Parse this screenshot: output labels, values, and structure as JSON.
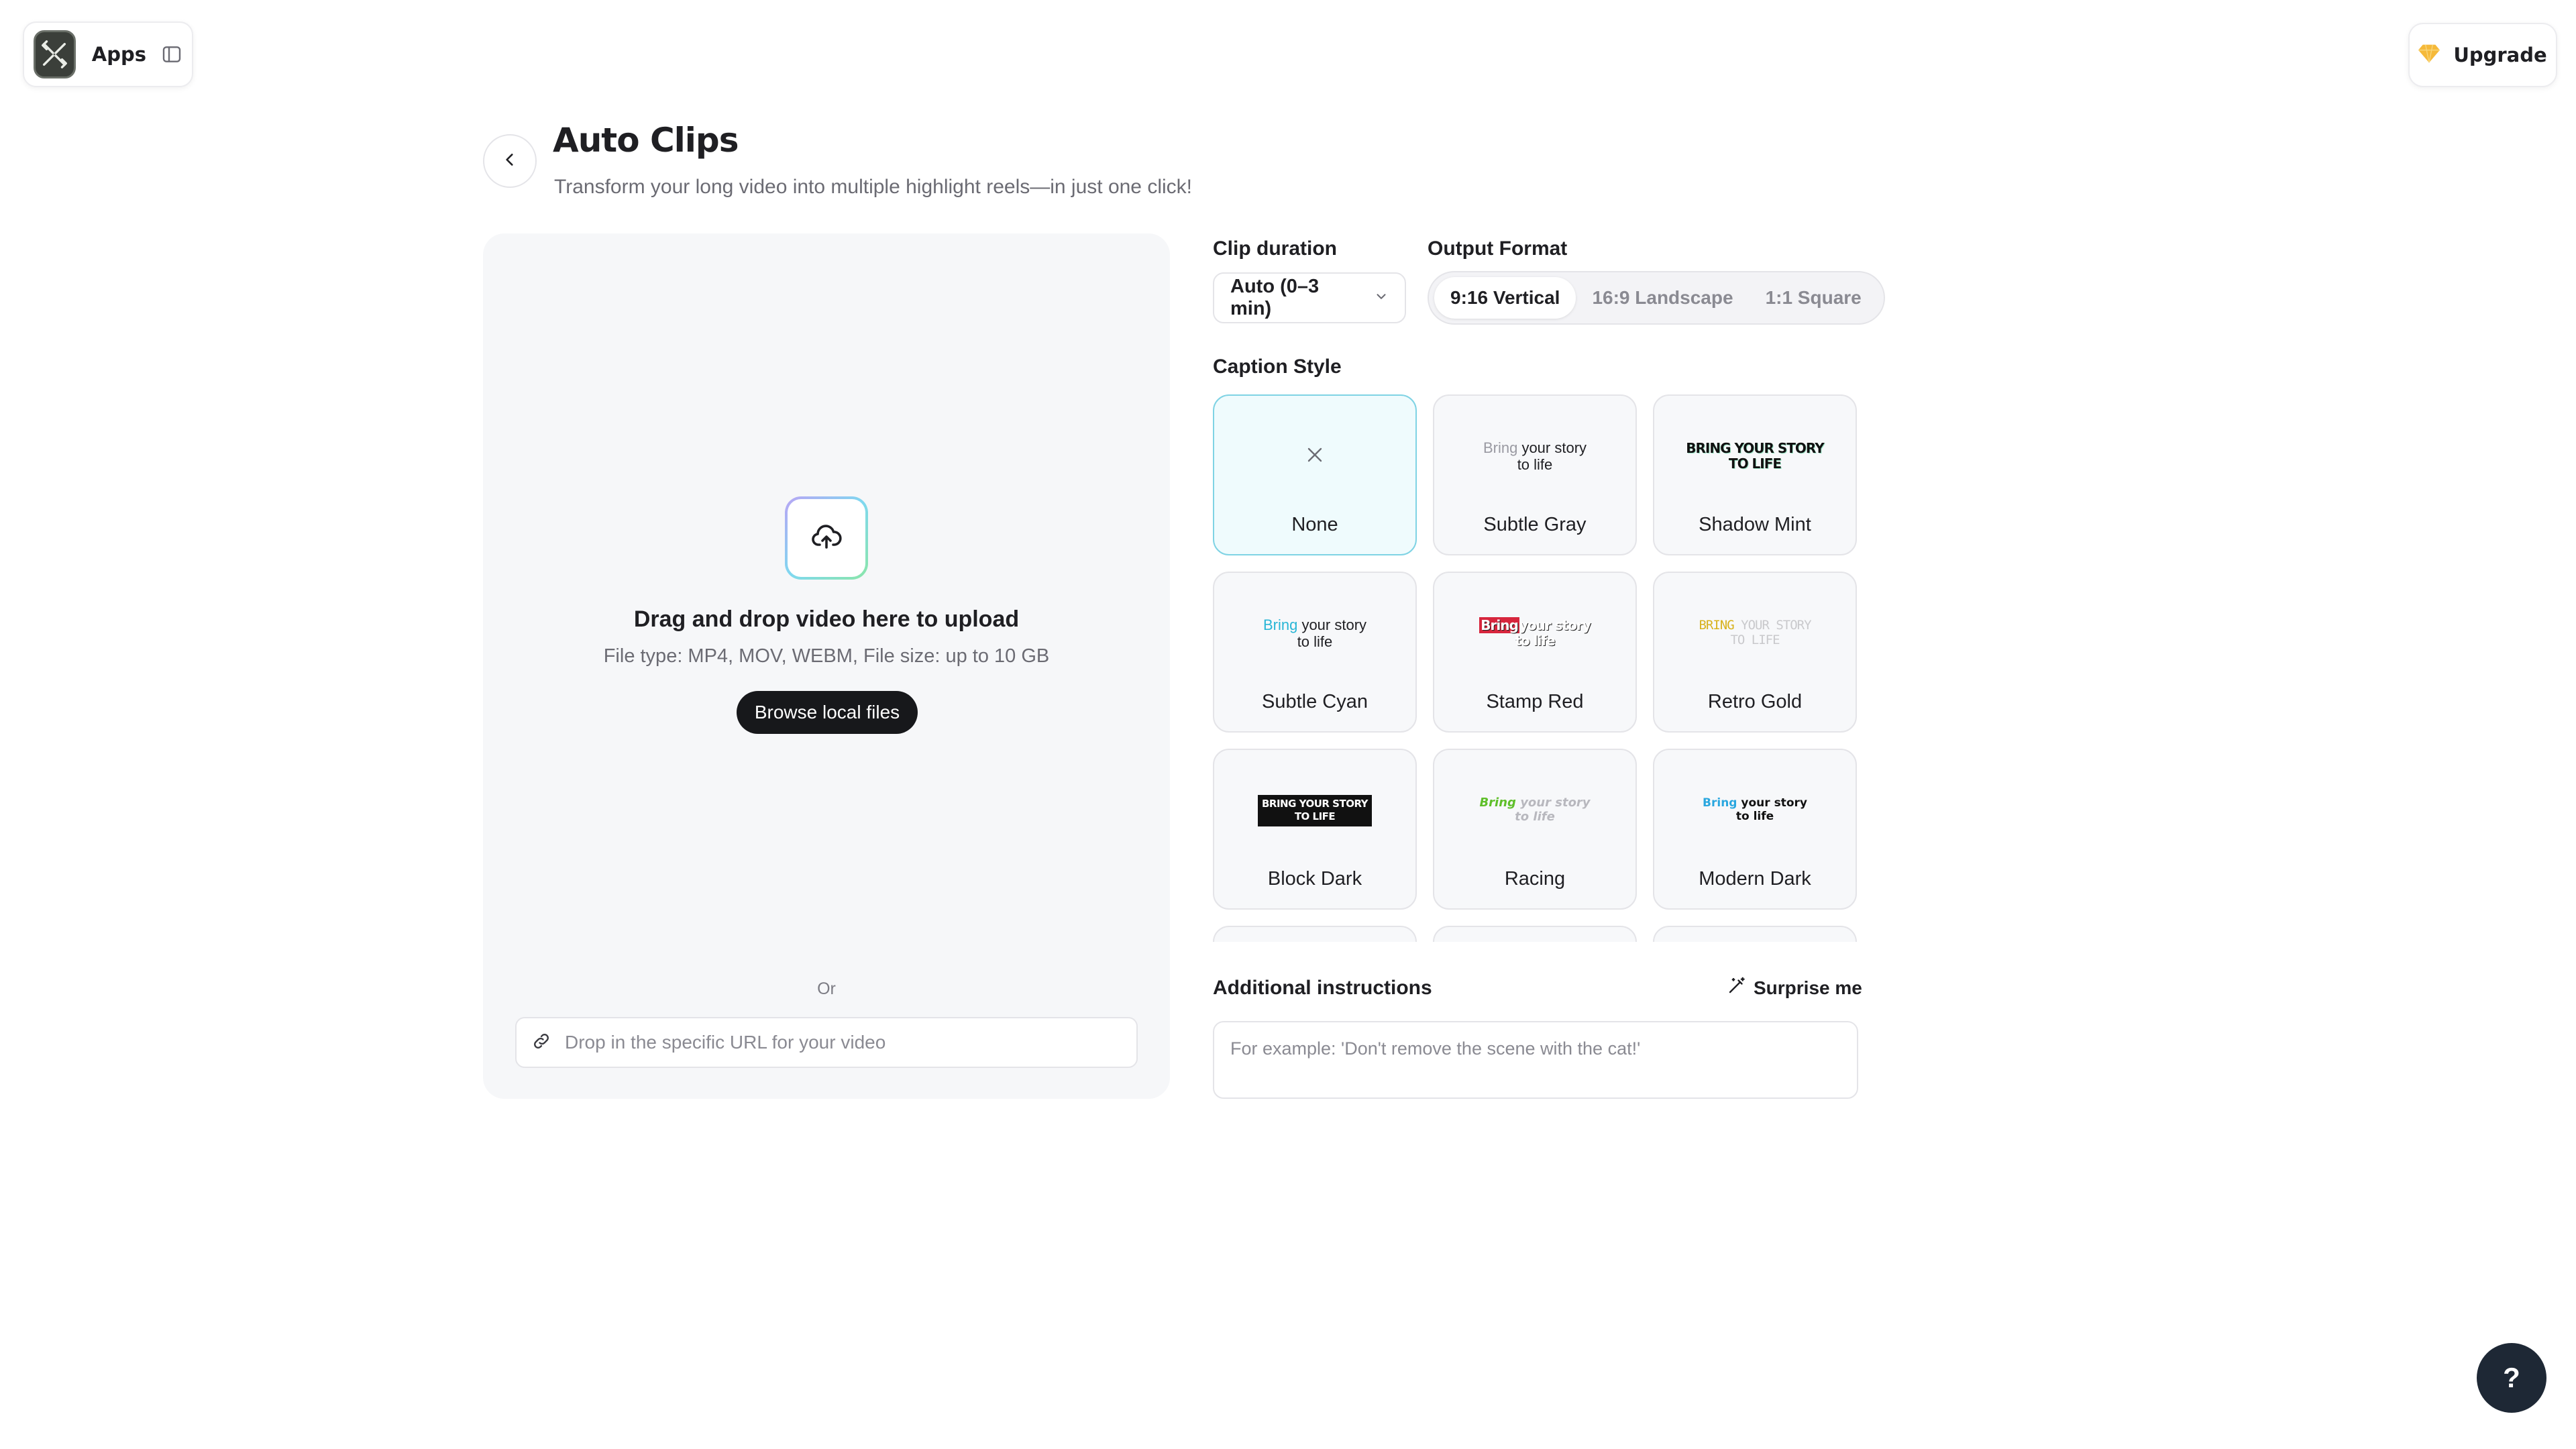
{
  "header": {
    "apps_label": "Apps",
    "upgrade_label": "Upgrade"
  },
  "page": {
    "title": "Auto Clips",
    "subtitle": "Transform your long video into multiple highlight reels—in just one click!"
  },
  "upload": {
    "title": "Drag and drop video here to upload",
    "description": "File type: MP4, MOV, WEBM, File size: up to 10 GB",
    "browse_label": "Browse local files",
    "or_label": "Or",
    "url_placeholder": "Drop in the specific URL for your video"
  },
  "settings": {
    "clip_duration_label": "Clip duration",
    "clip_duration_value": "Auto (0–3 min)",
    "output_format_label": "Output Format",
    "formats": [
      "9:16 Vertical",
      "16:9 Landscape",
      "1:1 Square"
    ],
    "selected_format": "9:16 Vertical",
    "caption_style_label": "Caption Style",
    "selected_caption": "None"
  },
  "captions": [
    {
      "name": "None"
    },
    {
      "name": "Subtle Gray",
      "preview_hl": "Bring",
      "preview_rest": "your story",
      "preview_line2": "to life"
    },
    {
      "name": "Shadow Mint",
      "preview_line1": "BRING YOUR STORY",
      "preview_line2": "TO LIFE"
    },
    {
      "name": "Subtle Cyan",
      "preview_hl": "Bring",
      "preview_rest": "your story",
      "preview_line2": "to life"
    },
    {
      "name": "Stamp Red",
      "preview_hl": "Bring",
      "preview_rest": "your story",
      "preview_line2": "to life"
    },
    {
      "name": "Retro Gold",
      "preview_hl": "BRING",
      "preview_rest": "YOUR STORY",
      "preview_line2": "TO LIFE"
    },
    {
      "name": "Block Dark",
      "preview_line1": "BRING YOUR STORY",
      "preview_line2": "TO LIFE"
    },
    {
      "name": "Racing",
      "preview_hl": "Bring",
      "preview_rest": "your story",
      "preview_line2": "to life"
    },
    {
      "name": "Modern Dark",
      "preview_hl": "Bring",
      "preview_rest": "your story",
      "preview_line2": "to life"
    }
  ],
  "instructions": {
    "label": "Additional instructions",
    "surprise_label": "Surprise me",
    "placeholder": "For example: 'Don't remove the scene with the cat!'"
  },
  "help": {
    "label": "?"
  },
  "colors": {
    "primary_dark": "#17181b",
    "selected_border": "#7fd3e4",
    "help_bg": "#1e2835",
    "upgrade_gem": "#f5b93a"
  }
}
